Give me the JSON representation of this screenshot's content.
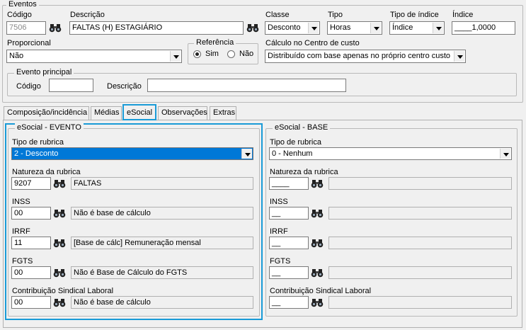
{
  "eventos": {
    "legend": "Eventos",
    "codigo_label": "Código",
    "codigo_value": "7506",
    "descricao_label": "Descrição",
    "descricao_value": "FALTAS (H) ESTAGIÁRIO",
    "classe_label": "Classe",
    "classe_value": "Desconto",
    "tipo_label": "Tipo",
    "tipo_value": "Horas",
    "tipo_indice_label": "Tipo de índice",
    "tipo_indice_value": "Índice",
    "indice_label": "Índice",
    "indice_value": "____1,0000",
    "proporcional_label": "Proporcional",
    "proporcional_value": "Não",
    "referencia_legend": "Referência",
    "ref_sim": "Sim",
    "ref_nao": "Não",
    "calculo_label": "Cálculo no Centro de custo",
    "calculo_value": "Distribuído com base apenas no próprio centro custo",
    "evento_principal_legend": "Evento principal",
    "ep_codigo_label": "Código",
    "ep_descricao_label": "Descrição"
  },
  "tabs": [
    "Composição/incidência",
    "Médias",
    "eSocial",
    "Observações",
    "Extras"
  ],
  "esocial_evento": {
    "legend": "eSocial - EVENTO",
    "tipo_rubrica_label": "Tipo de rubrica",
    "tipo_rubrica_value": "2 - Desconto",
    "natureza_label": "Natureza da rubrica",
    "natureza_code": "9207",
    "natureza_desc": "FALTAS",
    "inss_label": "INSS",
    "inss_code": "00",
    "inss_desc": "Não é base de cálculo",
    "irrf_label": "IRRF",
    "irrf_code": "11",
    "irrf_desc": "[Base de cálc] Remuneração mensal",
    "fgts_label": "FGTS",
    "fgts_code": "00",
    "fgts_desc": "Não é Base de Cálculo do FGTS",
    "contrib_label": "Contribuição Sindical Laboral",
    "contrib_code": "00",
    "contrib_desc": "Não é base de cálculo"
  },
  "esocial_base": {
    "legend": "eSocial - BASE",
    "tipo_rubrica_label": "Tipo de rubrica",
    "tipo_rubrica_value": "0 - Nenhum",
    "natureza_label": "Natureza da rubrica",
    "natureza_code": "____",
    "inss_label": "INSS",
    "inss_code": "__",
    "irrf_label": "IRRF",
    "irrf_code": "__",
    "fgts_label": "FGTS",
    "fgts_code": "__",
    "contrib_label": "Contribuição Sindical Laboral",
    "contrib_code": "__"
  },
  "colors": {
    "accent": "#1a9bd7",
    "selection": "#0078d7"
  }
}
